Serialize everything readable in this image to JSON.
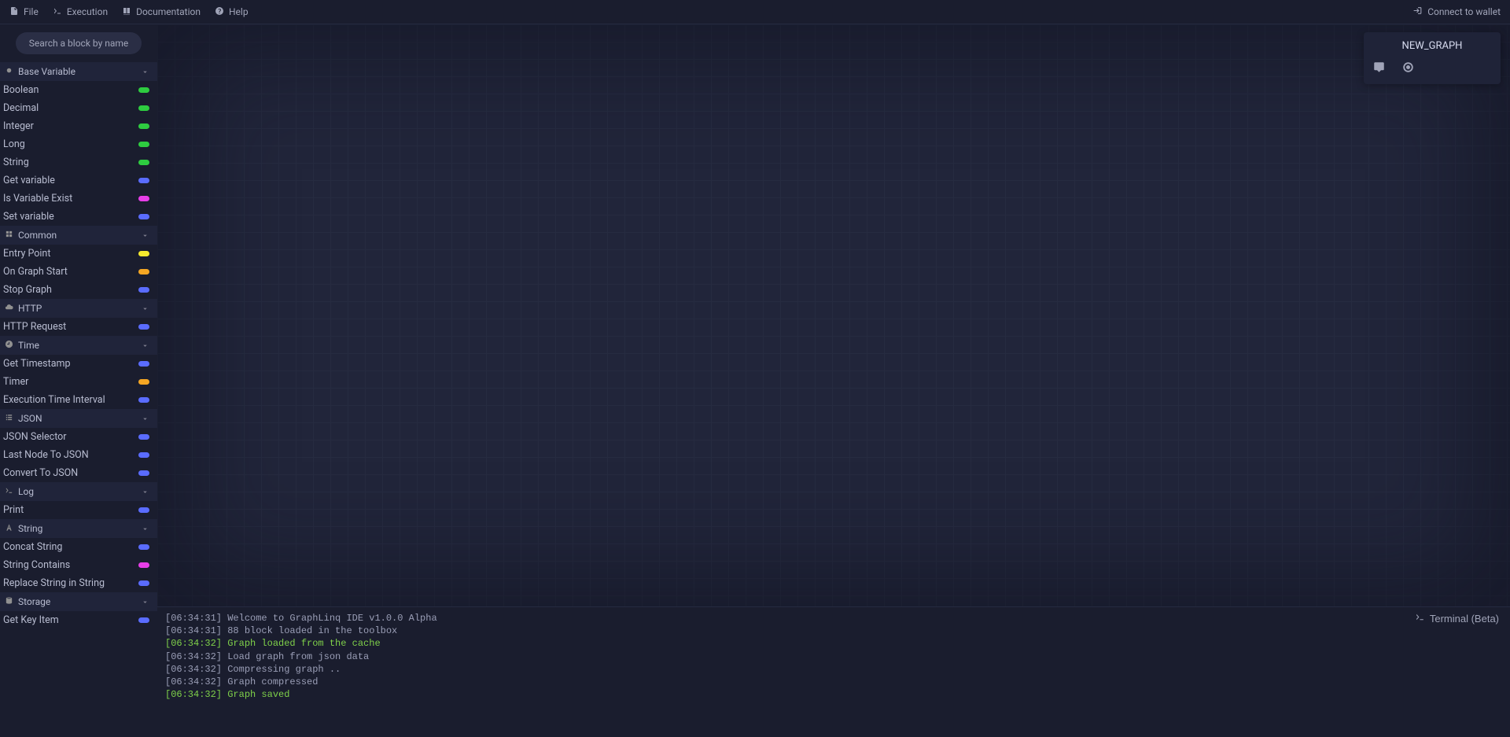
{
  "topbar": {
    "file": "File",
    "execution": "Execution",
    "documentation": "Documentation",
    "help": "Help",
    "connect": "Connect to wallet"
  },
  "search": {
    "placeholder": "Search a block by name"
  },
  "sidebar": [
    {
      "title": "Base Variable",
      "icon": "circle",
      "items": [
        {
          "label": "Boolean",
          "color": "green"
        },
        {
          "label": "Decimal",
          "color": "green"
        },
        {
          "label": "Integer",
          "color": "green"
        },
        {
          "label": "Long",
          "color": "green"
        },
        {
          "label": "String",
          "color": "green"
        },
        {
          "label": "Get variable",
          "color": "blue"
        },
        {
          "label": "Is Variable Exist",
          "color": "magenta"
        },
        {
          "label": "Set variable",
          "color": "blue"
        }
      ]
    },
    {
      "title": "Common",
      "icon": "grid",
      "items": [
        {
          "label": "Entry Point",
          "color": "yellow"
        },
        {
          "label": "On Graph Start",
          "color": "orange"
        },
        {
          "label": "Stop Graph",
          "color": "blue"
        }
      ]
    },
    {
      "title": "HTTP",
      "icon": "cloud",
      "items": [
        {
          "label": "HTTP Request",
          "color": "blue"
        }
      ]
    },
    {
      "title": "Time",
      "icon": "clock",
      "items": [
        {
          "label": "Get Timestamp",
          "color": "blue"
        },
        {
          "label": "Timer",
          "color": "orange"
        },
        {
          "label": "Execution Time Interval",
          "color": "blue"
        }
      ]
    },
    {
      "title": "JSON",
      "icon": "list",
      "items": [
        {
          "label": "JSON Selector",
          "color": "blue"
        },
        {
          "label": "Last Node To JSON",
          "color": "blue"
        },
        {
          "label": "Convert To JSON",
          "color": "blue"
        }
      ]
    },
    {
      "title": "Log",
      "icon": "terminal",
      "items": [
        {
          "label": "Print",
          "color": "blue"
        }
      ]
    },
    {
      "title": "String",
      "icon": "font",
      "items": [
        {
          "label": "Concat String",
          "color": "blue"
        },
        {
          "label": "String Contains",
          "color": "magenta"
        },
        {
          "label": "Replace String in String",
          "color": "blue"
        }
      ]
    },
    {
      "title": "Storage",
      "icon": "database",
      "items": [
        {
          "label": "Get Key Item",
          "color": "blue"
        }
      ]
    }
  ],
  "graph": {
    "title": "NEW_GRAPH"
  },
  "terminal": {
    "label": "Terminal (Beta)",
    "lines": [
      {
        "text": "[06:34:31] Welcome to GraphLinq IDE v1.0.0 Alpha",
        "style": ""
      },
      {
        "text": "[06:34:31] 88 block loaded in the toolbox",
        "style": ""
      },
      {
        "text": "[06:34:32] Graph loaded from the cache",
        "style": "green"
      },
      {
        "text": "[06:34:32] Load graph from json data",
        "style": ""
      },
      {
        "text": "[06:34:32] Compressing graph ..",
        "style": ""
      },
      {
        "text": "[06:34:32] Graph compressed",
        "style": ""
      },
      {
        "text": "[06:34:32] Graph saved",
        "style": "green"
      }
    ]
  }
}
